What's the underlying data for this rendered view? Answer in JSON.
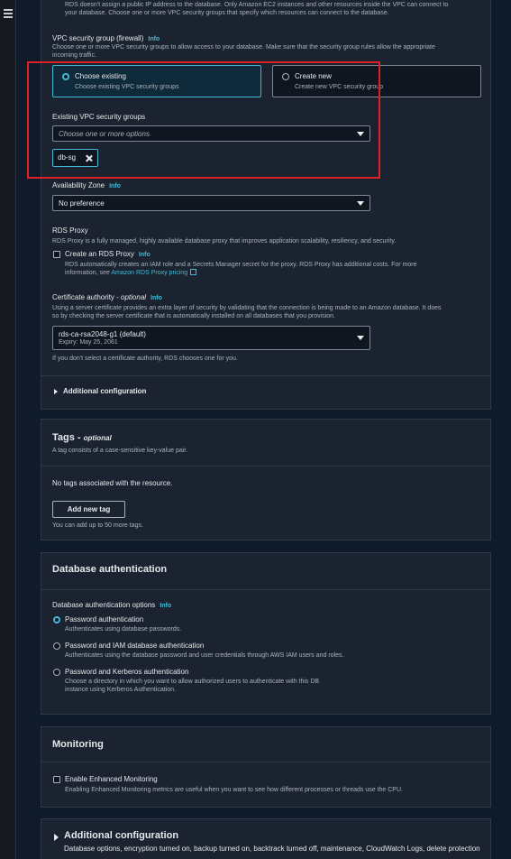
{
  "nav": {
    "menu_icon": "hamburger-icon"
  },
  "connectivity": {
    "top_desc_line1": "RDS doesn't assign a public IP address to the database. Only Amazon EC2 instances and other resources inside the VPC can connect to",
    "top_desc_line2": "your database. Choose one or more VPC security groups that specify which resources can connect to the database.",
    "vpc_sg_label": "VPC security group (firewall)",
    "info": "Info",
    "vpc_sg_desc_line1": "Choose one or more VPC security groups to allow access to your database. Make sure that the security group rules allow the appropriate",
    "vpc_sg_desc_line2": "incoming traffic.",
    "choose_existing_title": "Choose existing",
    "choose_existing_desc": "Choose existing VPC security groups",
    "create_new_title": "Create new",
    "create_new_desc": "Create new VPC security group",
    "existing_sg_label": "Existing VPC security groups",
    "existing_sg_placeholder": "Choose one or more options",
    "selected_tag": "db-sg",
    "az_label": "Availability Zone",
    "az_value": "No preference",
    "rds_proxy_title": "RDS Proxy",
    "rds_proxy_desc": "RDS Proxy is a fully managed, highly available database proxy that improves application scalability, resiliency, and security.",
    "create_proxy_label": "Create an RDS Proxy",
    "create_proxy_desc_line1": "RDS automatically creates an IAM role and a Secrets Manager secret for the proxy. RDS Proxy has additional costs. For more",
    "create_proxy_desc_line2_prefix": "information, see ",
    "create_proxy_link": "Amazon RDS Proxy pricing",
    "cert_label": "Certificate authority",
    "cert_optional": "optional",
    "cert_desc_line1": "Using a server certificate provides an extra layer of security by validating that the connection is being made to an Amazon database. It does",
    "cert_desc_line2": "so by checking the server certificate that is automatically installed on all databases that you provision.",
    "cert_value": "rds-ca-rsa2048-g1 (default)",
    "cert_expiry": "Expiry: May 25, 2061",
    "cert_hint": "If you don't select a certificate authority, RDS chooses one for you.",
    "additional_config": "Additional configuration"
  },
  "tags": {
    "title": "Tags",
    "optional": "optional",
    "desc": "A tag consists of a case-sensitive key-value pair.",
    "empty": "No tags associated with the resource.",
    "add_button": "Add new tag",
    "limit": "You can add up to 50 more tags."
  },
  "db_auth": {
    "title": "Database authentication",
    "options_label": "Database authentication options",
    "info": "Info",
    "options": [
      {
        "title": "Password authentication",
        "desc": "Authenticates using database passwords.",
        "selected": true
      },
      {
        "title": "Password and IAM database authentication",
        "desc": "Authenticates using the database password and user credentials through AWS IAM users and roles.",
        "selected": false
      },
      {
        "title": "Password and Kerberos authentication",
        "desc": "Choose a directory in which you want to allow authorized users to authenticate with this DB",
        "desc2": "instance using Kerberos Authentication.",
        "selected": false
      }
    ]
  },
  "monitoring": {
    "title": "Monitoring",
    "enhanced_label": "Enable Enhanced Monitoring",
    "enhanced_desc": "Enabling Enhanced Monitoring metrics are useful when you want to see how different processes or threads use the CPU."
  },
  "additional": {
    "title": "Additional configuration",
    "desc": "Database options, encryption turned on, backup turned on, backtrack turned off, maintenance, CloudWatch Logs, delete protection"
  },
  "colors": {
    "accent": "#44b9d6",
    "highlight": "#e01f26",
    "background": "#0f1b2a",
    "panel": "#1a232f"
  }
}
